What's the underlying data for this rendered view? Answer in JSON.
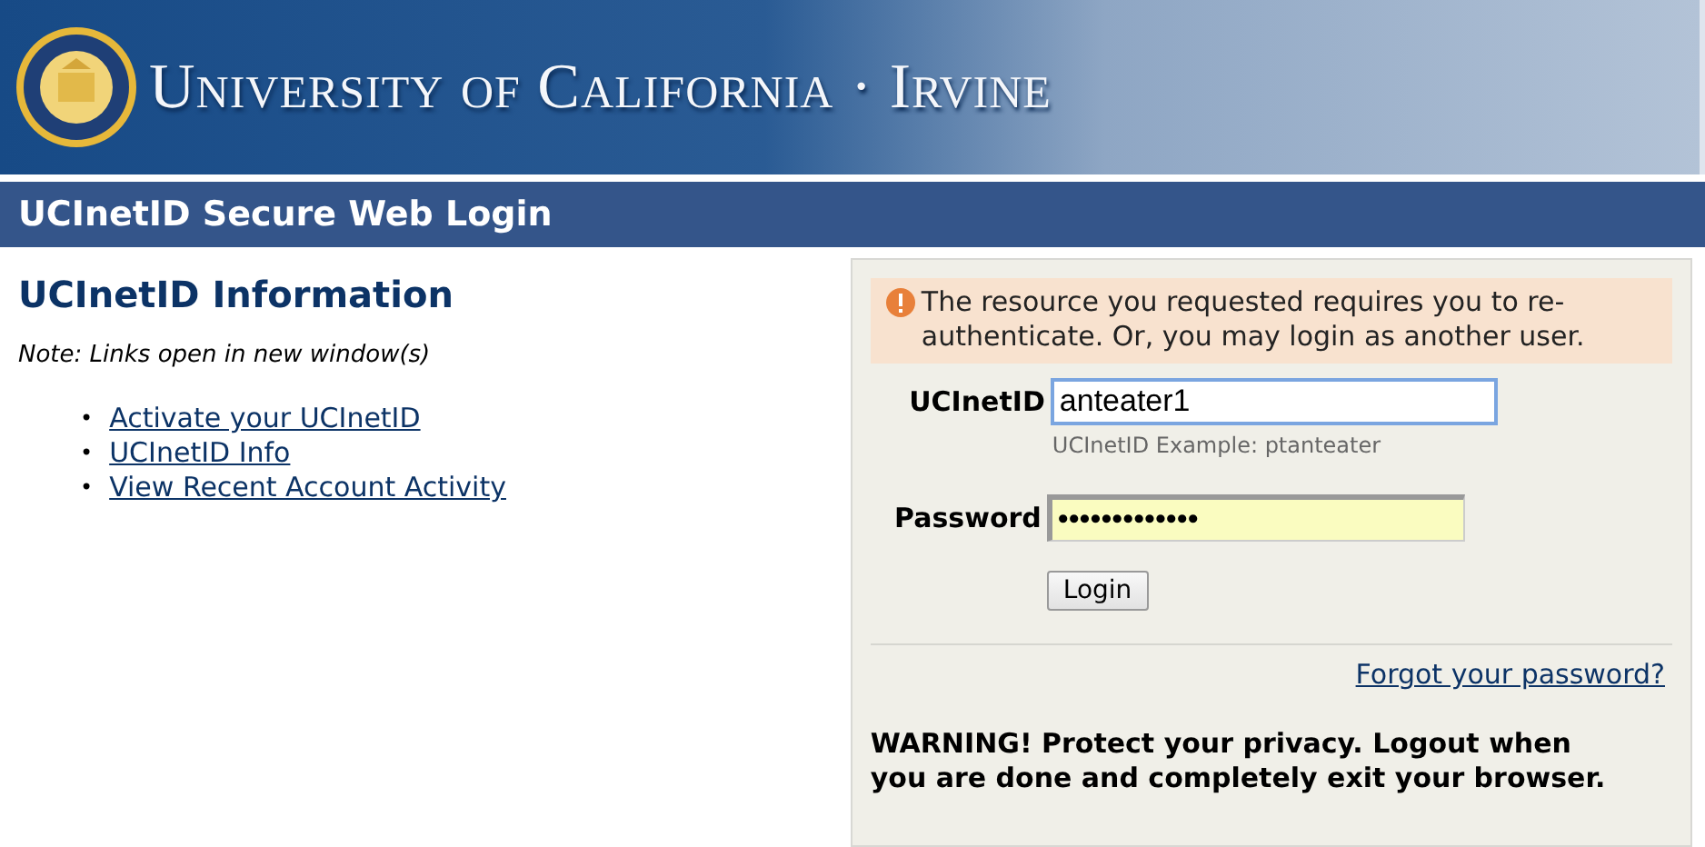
{
  "banner": {
    "title": "University of California · Irvine"
  },
  "title_bar": {
    "title": "UCInetID Secure Web Login"
  },
  "info": {
    "heading": "UCInetID Information",
    "note": "Note: Links open in new window(s)",
    "links": [
      {
        "bullet": "•",
        "label": "Activate your UCInetID"
      },
      {
        "bullet": "•",
        "label": "UCInetID Info"
      },
      {
        "bullet": "•",
        "label": "View Recent Account Activity"
      }
    ]
  },
  "login": {
    "alert": "The resource you requested requires you to re-authenticate. Or, you may login as another user.",
    "fields": [
      {
        "label": "UCInetID",
        "value": "anteater1",
        "hint": "UCInetID Example: ptanteater",
        "focused": true,
        "autofilled": false
      },
      {
        "label": "Password",
        "value": "•••••••••••••",
        "focused": false,
        "autofilled": true
      }
    ],
    "button": "Login",
    "forgot_link": "Forgot your password?",
    "warning": "WARNING! Protect your privacy. Logout when you are done and completely exit your browser."
  }
}
